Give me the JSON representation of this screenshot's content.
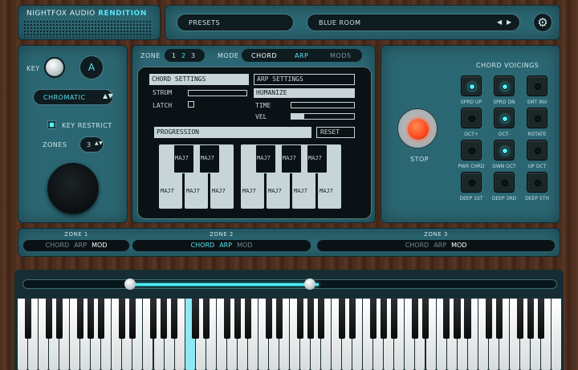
{
  "header": {
    "brand": "NIGHTFOX AUDIO",
    "product": "RENDITION",
    "presets_label": "PRESETS",
    "preset_name": "BLUE ROOM"
  },
  "left": {
    "key_label": "KEY",
    "key_value": "A",
    "scale": "CHROMATIC",
    "key_restrict": "KEY RESTRICT",
    "zones_label": "ZONES",
    "zones_value": "3"
  },
  "center": {
    "zone_label": "ZONE",
    "zones": [
      "1",
      "2",
      "3"
    ],
    "active_zone": "2",
    "mode_label": "MODE",
    "modes": [
      "CHORD",
      "ARP",
      "MODS"
    ],
    "active_mode": "CHORD",
    "chord_settings": "CHORD SETTINGS",
    "arp_settings": "ARP SETTINGS",
    "strum": "STRUM",
    "latch": "LATCH",
    "humanize": "HUMANIZE",
    "time": "TIME",
    "vel": "VEL",
    "progression": "PROGRESSION",
    "reset": "RESET",
    "vel_fraction": 0.2,
    "upper_cards": [
      "MAJ7",
      "MAJ7",
      "MAJ7",
      "MAJ7",
      "MAJ7"
    ],
    "lower_cards": [
      "MAJ7",
      "MAJ7",
      "MAJ7",
      "MAJ7",
      "MAJ7",
      "MAJ7",
      "MAJ7"
    ]
  },
  "right": {
    "title": "CHORD VOICINGS",
    "stop": "STOP",
    "voicings": [
      {
        "label": "SPRD UP",
        "on": true
      },
      {
        "label": "SPRD DN",
        "on": true
      },
      {
        "label": "SMT INV",
        "on": false
      },
      {
        "label": "OCT+",
        "on": false
      },
      {
        "label": "OCT-",
        "on": true
      },
      {
        "label": "ROTATE",
        "on": false
      },
      {
        "label": "PWR CHRD",
        "on": false
      },
      {
        "label": "DWN OCT",
        "on": true
      },
      {
        "label": "UP OCT",
        "on": false
      },
      {
        "label": "DEEP 1ST",
        "on": false
      },
      {
        "label": "DEEP 3RD",
        "on": false
      },
      {
        "label": "DEEP 5TH",
        "on": false
      }
    ]
  },
  "zone_strip": [
    {
      "title": "ZONE 1",
      "active": "MOD"
    },
    {
      "title": "ZONE 2",
      "active": "CHORD,ARP"
    },
    {
      "title": "ZONE 3",
      "active": "MOD"
    }
  ],
  "zone_modes": [
    "CHORD",
    "ARP",
    "MOD"
  ],
  "colors": {
    "accent": "#4ff2ff",
    "panel": "#2b6773",
    "stop": "#ff4a1c"
  }
}
